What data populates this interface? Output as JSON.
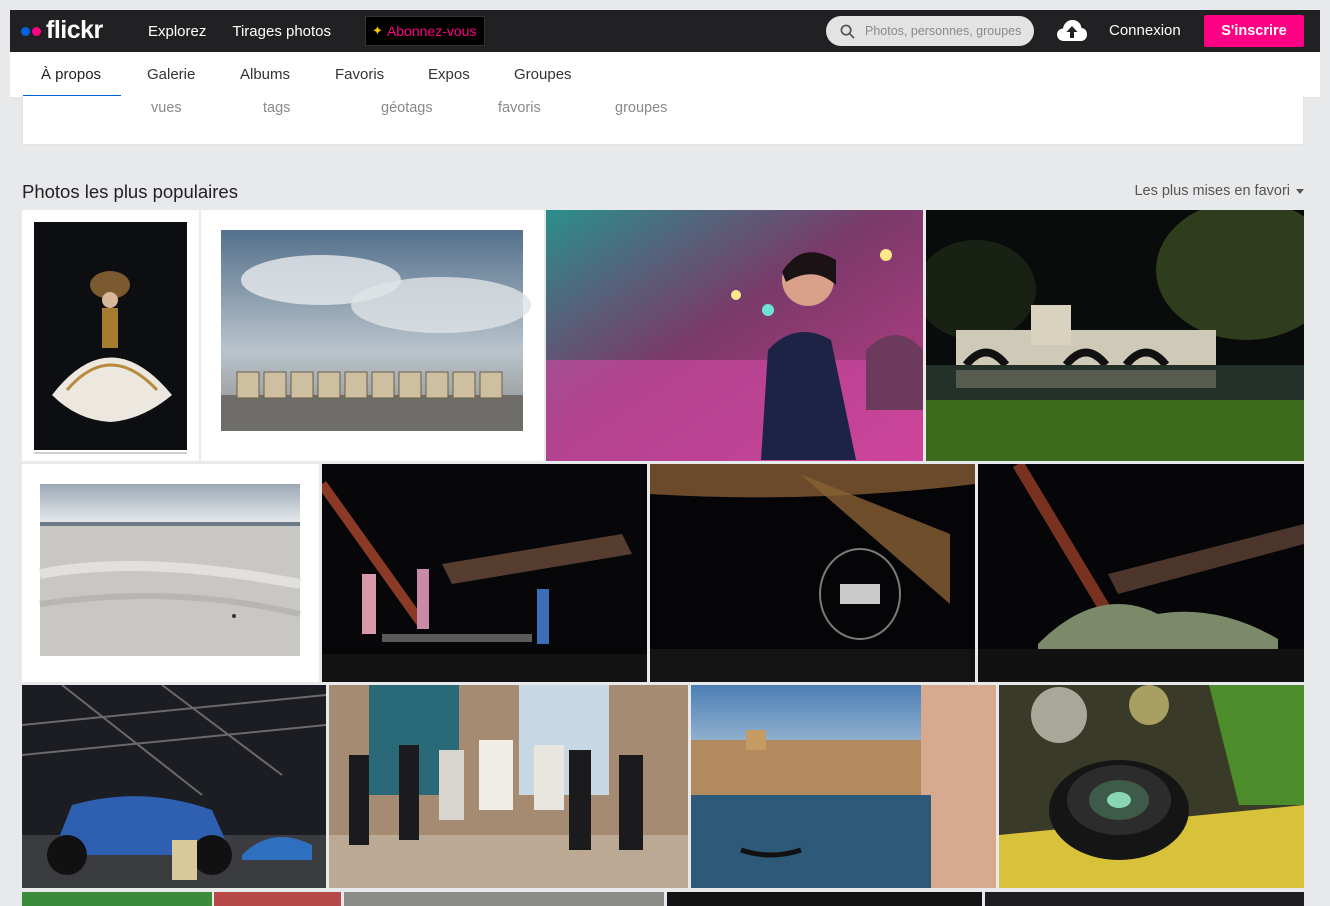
{
  "brand": {
    "name": "flickr"
  },
  "topnav": {
    "explore": "Explorez",
    "prints": "Tirages photos",
    "subscribe": "Abonnez-vous",
    "search_placeholder": "Photos, personnes, groupes",
    "login": "Connexion",
    "signup": "S'inscrire"
  },
  "tabs": [
    "À propos",
    "Galerie",
    "Albums",
    "Favoris",
    "Expos",
    "Groupes"
  ],
  "stats": [
    "vues",
    "tags",
    "géotags",
    "favoris",
    "groupes"
  ],
  "section": {
    "title": "Photos les plus populaires",
    "sort": "Les plus mises en favori"
  },
  "colors": {
    "topbar": "#212124",
    "accent_pink": "#ff0084",
    "accent_blue": "#0063dc"
  },
  "icons": {
    "search": "search-icon",
    "upload": "cloud-upload-icon",
    "sort": "caret-down-icon"
  }
}
